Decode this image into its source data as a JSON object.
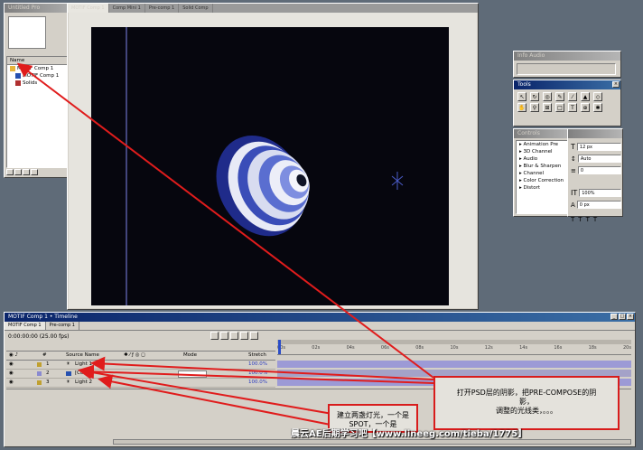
{
  "project_panel": {
    "title": "Untitled Pro",
    "col_name": "Name",
    "items": [
      {
        "label": "MOTIF Comp 1"
      },
      {
        "label": "MOTIF Comp 1"
      },
      {
        "label": "Solids"
      }
    ]
  },
  "comp_window": {
    "tabs": [
      "MOTIF Comp 1",
      "Comp Mini 1",
      "Pre-comp 1",
      "Solid Comp"
    ]
  },
  "right_panels": {
    "tools_title": "Tools",
    "info_title": "Info Audio",
    "effects_title": "Controls",
    "effects": [
      "Animation Pre",
      "3D Channel",
      "Audio",
      "Blur & Sharpen",
      "Channel",
      "Color Correction",
      "Distort"
    ],
    "char_fields": [
      "12 px",
      "Auto",
      "0",
      "100%",
      "0 px"
    ]
  },
  "timeline": {
    "title": "MOTIF Comp 1 • Timeline",
    "tabs": [
      "MOTIF Comp 1",
      "Pre-comp 1"
    ],
    "timecode": "0:00:00:00 (25.00 fps)",
    "col_source": "Source Name",
    "col_mode": "Mode",
    "col_stretch": "Stretch",
    "layers": [
      {
        "num": "1",
        "name": "Light 1",
        "stretch": "100.0%"
      },
      {
        "num": "2",
        "name": "[Comp]",
        "stretch": "100.0%"
      },
      {
        "num": "3",
        "name": "Light 2",
        "stretch": "100.0%"
      }
    ],
    "ruler": [
      "00s",
      "02s",
      "04s",
      "06s",
      "08s",
      "10s",
      "12s",
      "14s",
      "16s",
      "18s",
      "20s"
    ]
  },
  "annotations": {
    "note1_line1": "打开PSD层的阴影，把PRE-COMPOSE的阴",
    "note1_line2": "影，",
    "note1_line3": "调整的光线类，。。。",
    "note2_line1": "建立两盏灯光，一个是",
    "note2_line2": "SPOT，一个是"
  },
  "watermark": "晨云AE后期学习吧【www.lineeg.com/tieba/1775】",
  "colors": {
    "title_active": "#0a246a",
    "window_face": "#d4d0c8",
    "desktop": "#5f6b78",
    "comp_bg": "#06060e",
    "annotation_red": "#d81c1c"
  }
}
